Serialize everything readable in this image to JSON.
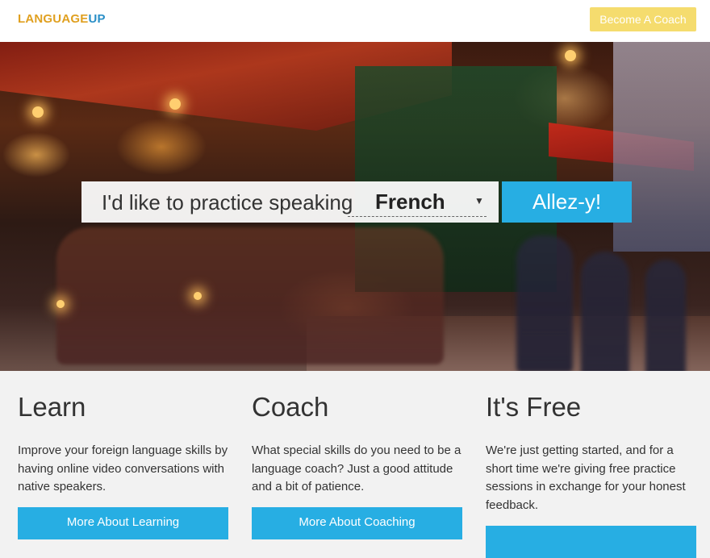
{
  "header": {
    "logo_part1": "LANGUAGE",
    "logo_part2": "UP",
    "coach_button": "Become A Coach"
  },
  "hero": {
    "prompt": "I'd like to practice speaking",
    "language_selected": "French",
    "go_button": "Allez-y!"
  },
  "features": [
    {
      "title": "Learn",
      "text": "Improve your foreign language skills by having online video conversations with native speakers.",
      "button": "More About Learning"
    },
    {
      "title": "Coach",
      "text": "What special skills do you need to be a language coach? Just a good attitude and a bit of patience.",
      "button": "More About Coaching"
    },
    {
      "title": "It's Free",
      "text": "We're just getting started, and for a short time we're giving free practice sessions in exchange for your honest feedback.",
      "button": ""
    }
  ],
  "colors": {
    "accent": "#27aee3",
    "coach_button": "#f5dc6e",
    "logo_orange": "#e0a020",
    "logo_blue": "#2a8fc7"
  }
}
